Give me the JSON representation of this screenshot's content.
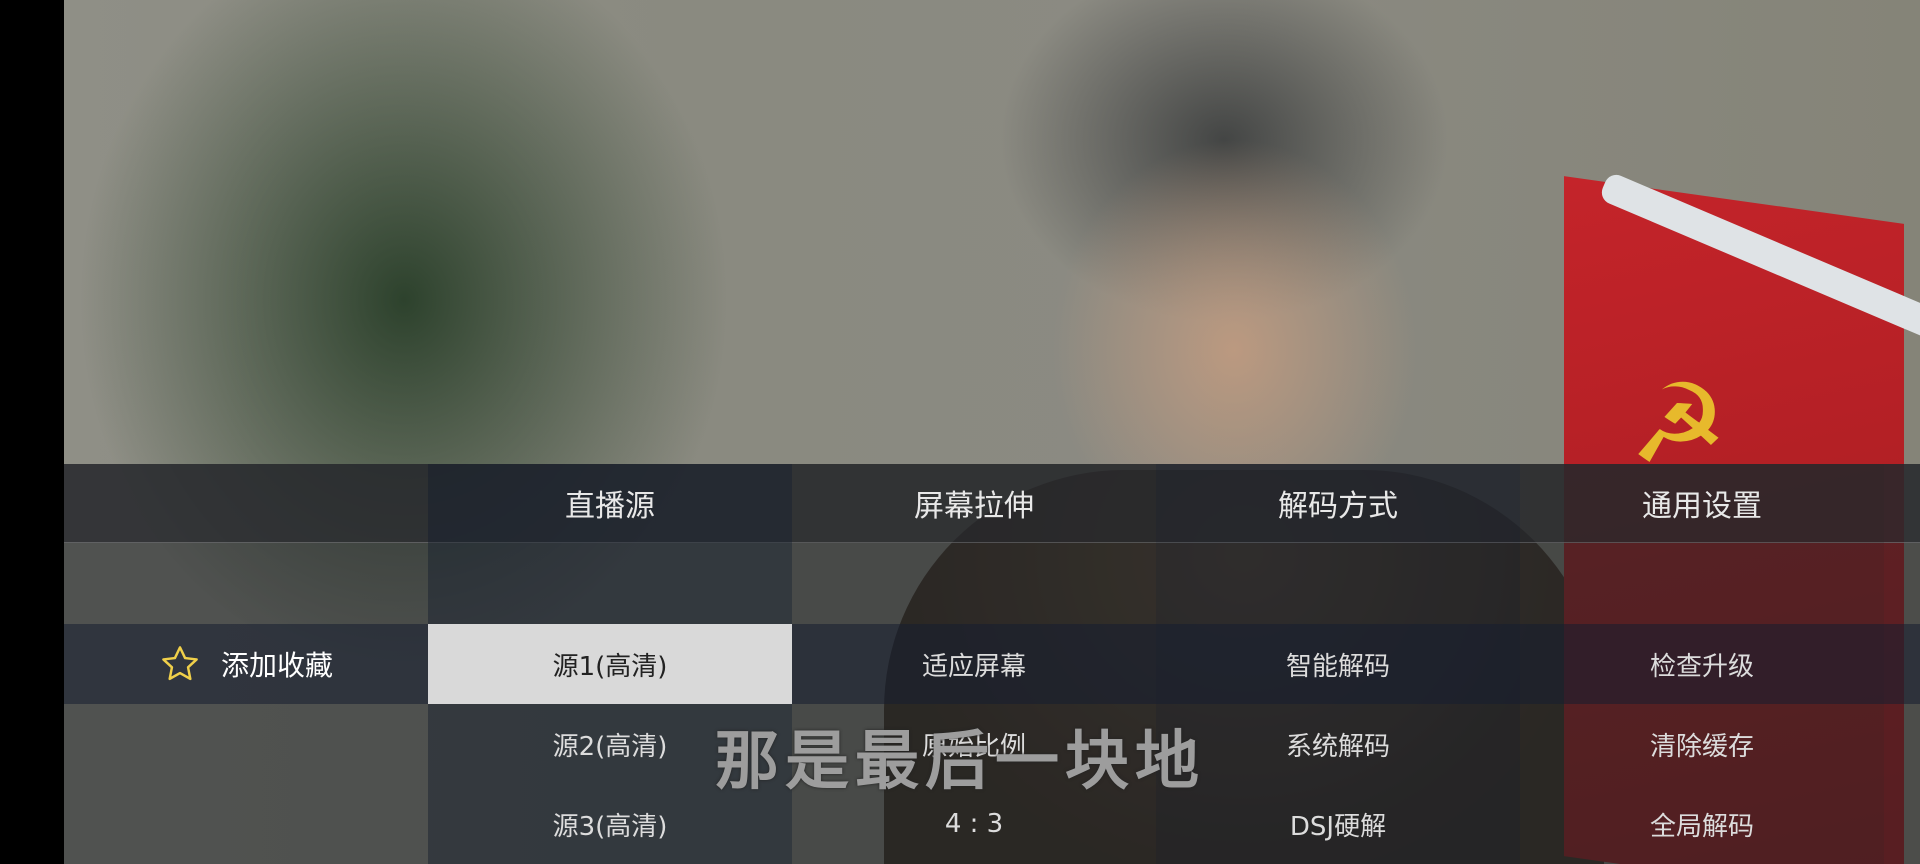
{
  "tabs": [
    "直播源",
    "屏幕拉伸",
    "解码方式",
    "通用设置"
  ],
  "favorite": {
    "label": "添加收藏",
    "icon": "star-outline-icon",
    "icon_color": "#f0d04a"
  },
  "columns": {
    "source": {
      "items": [
        "源1(高清)",
        "源2(高清)",
        "源3(高清)"
      ],
      "selected_index": 0
    },
    "stretch": {
      "items": [
        "适应屏幕",
        "原始比例",
        "4 : 3"
      ]
    },
    "decode": {
      "items": [
        "智能解码",
        "系统解码",
        "DSJ硬解"
      ]
    },
    "settings": {
      "items": [
        "检查升级",
        "清除缓存",
        "全局解码"
      ]
    }
  },
  "video": {
    "subtitle": "那是最后一块地"
  },
  "colors": {
    "selected_bg": "#d9d9d9",
    "selected_text": "#222222",
    "menu_text": "#dcdcdc"
  }
}
